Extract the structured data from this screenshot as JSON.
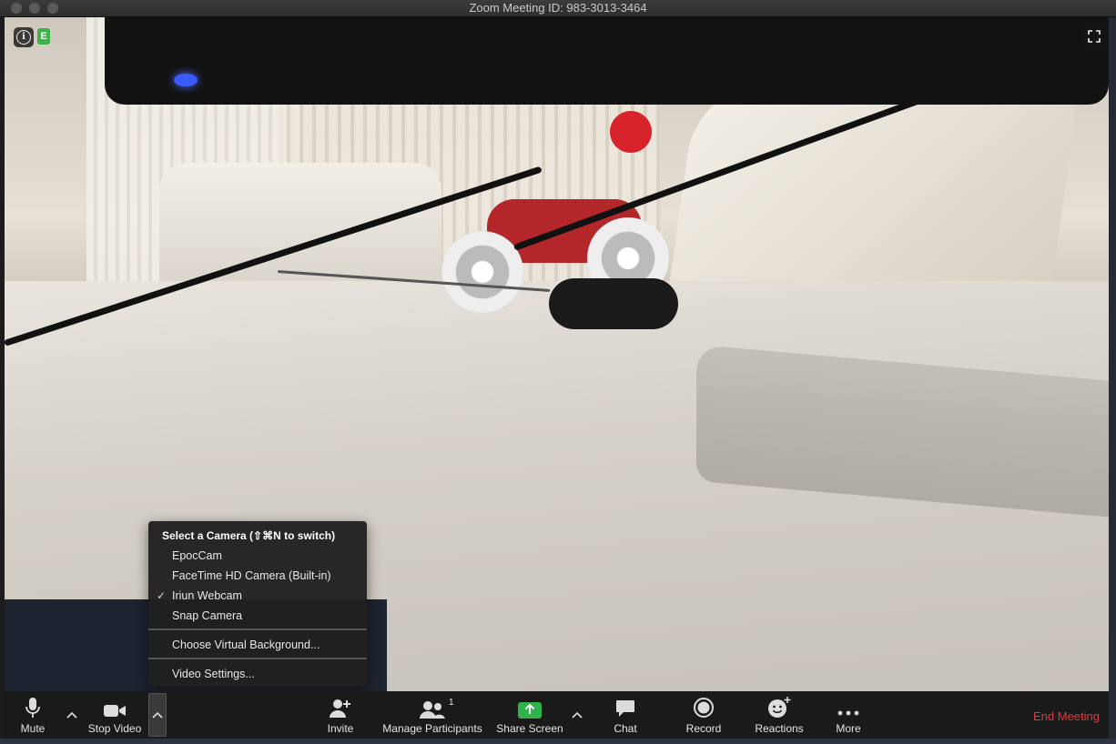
{
  "window": {
    "title": "Zoom Meeting ID: 983-3013-3464"
  },
  "overlay": {
    "info_icon": "info-icon",
    "encryption_badge": "E",
    "fullscreen_icon": "fullscreen-icon"
  },
  "camera_menu": {
    "header": "Select a Camera (⇧⌘N to switch)",
    "cameras": [
      {
        "label": "EpocCam",
        "checked": false
      },
      {
        "label": "FaceTime HD Camera (Built-in)",
        "checked": false
      },
      {
        "label": "Iriun Webcam",
        "checked": true
      },
      {
        "label": "Snap Camera",
        "checked": false
      }
    ],
    "check_mark": "✓",
    "virtual_background": "Choose Virtual Background...",
    "video_settings": "Video Settings..."
  },
  "toolbar": {
    "mute": "Mute",
    "stop_video": "Stop Video",
    "invite": "Invite",
    "manage_participants": "Manage Participants",
    "participant_count": "1",
    "share_screen": "Share Screen",
    "chat": "Chat",
    "record": "Record",
    "reactions": "Reactions",
    "more": "More",
    "end_meeting": "End Meeting"
  },
  "colors": {
    "share_green": "#2fb34a",
    "end_red": "#e0393e",
    "toolbar_bg": "#1a1a1a"
  }
}
